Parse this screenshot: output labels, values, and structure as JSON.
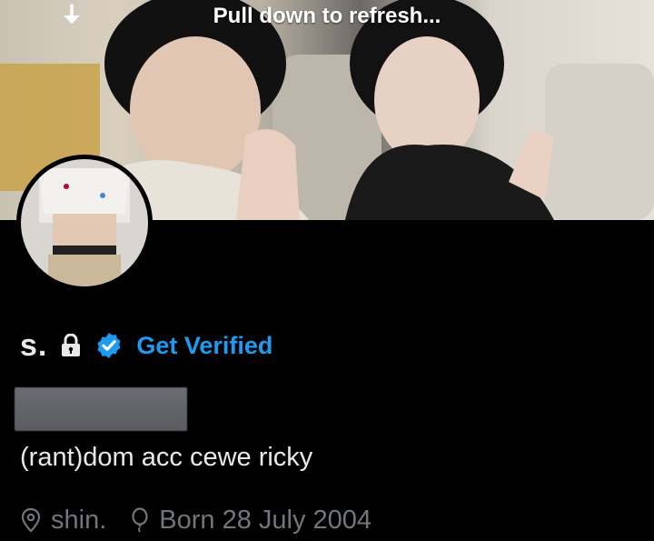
{
  "header": {
    "refresh_text": "Pull down to refresh..."
  },
  "profile": {
    "display_name": "s.",
    "get_verified_label": "Get Verified",
    "bio": "(rant)dom acc cewe ricky",
    "location": "shin.",
    "birthday": "Born 28 July 2004"
  },
  "colors": {
    "accent": "#1d9bf0",
    "text_primary": "#e7e9ea",
    "text_secondary": "#71767b",
    "background": "#000000"
  },
  "icons": [
    "arrow-down-icon",
    "lock-icon",
    "verified-badge-icon",
    "location-pin-icon",
    "balloon-icon"
  ]
}
